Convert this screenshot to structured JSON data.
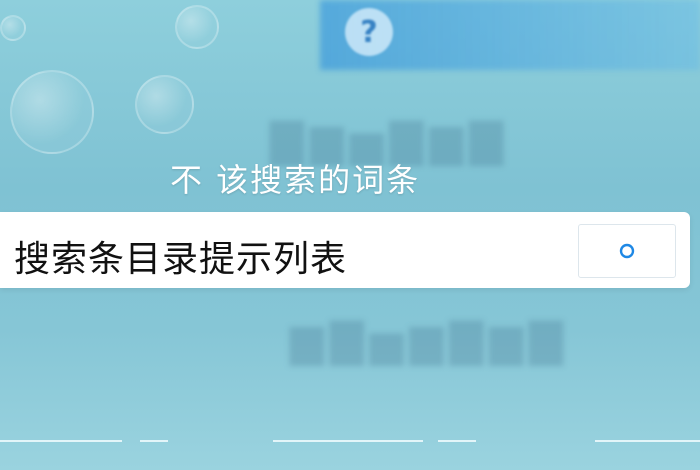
{
  "headline": "不 该搜索的词条",
  "search": {
    "query": "搜索条目录提示列表",
    "button_icon": "search-circle-icon"
  },
  "colors": {
    "background": "#86c6d6",
    "search_bar": "#ffffff",
    "accent": "#1e88e5"
  }
}
